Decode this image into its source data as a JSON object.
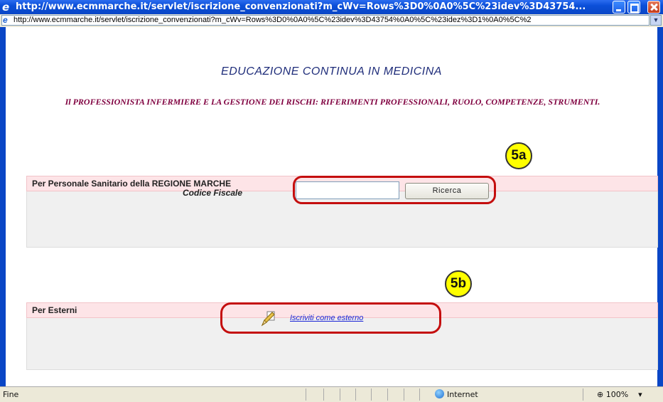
{
  "window": {
    "title": "http://www.ecmmarche.it/servlet/iscrizione_convenzionati?m_cWv=Rows%3D0%0A0%5C%23idev%3D43754...",
    "address": "http://www.ecmmarche.it/servlet/iscrizione_convenzionati?m_cWv=Rows%3D0%0A0%5C%23idev%3D43754%0A0%5C%23idez%3D1%0A0%5C%2"
  },
  "page": {
    "heading": "EDUCAZIONE CONTINUA IN MEDICINA",
    "course_title": "Il PROFESSIONISTA INFERMIERE E LA GESTIONE DEI RISCHI: RIFERIMENTI PROFESSIONALI, RUOLO, COMPETENZE, STRUMENTI."
  },
  "section_regional": {
    "header": "Per Personale Sanitario della REGIONE MARCHE",
    "field_label": "Codice Fiscale",
    "field_value": "",
    "search_button": "Ricerca",
    "badge": "5a"
  },
  "section_external": {
    "header": "Per Esterni",
    "link_label": "Iscriviti come esterno",
    "icon": "pencil-icon",
    "badge": "5b"
  },
  "status_bar": {
    "status": "Fine",
    "zone": "Internet",
    "zoom": "100%",
    "zoom_arrow": "▾"
  },
  "colors": {
    "heading": "#1f2d7a",
    "course_title": "#800040",
    "section_header_bg": "#fde4e7",
    "highlight": "#c40e0e",
    "badge": "#ffff00"
  }
}
